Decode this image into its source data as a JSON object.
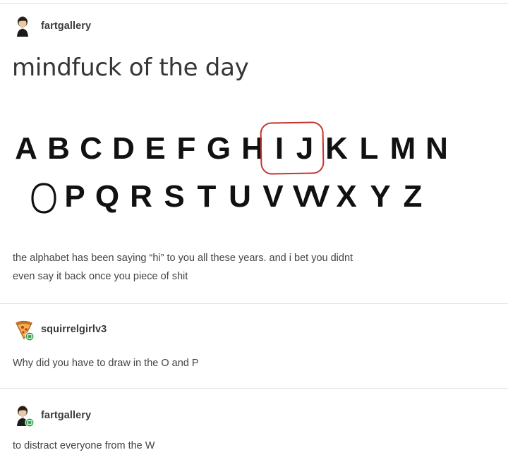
{
  "post": {
    "username": "fartgallery",
    "title": "mindfuck of the day",
    "alphabet_row1": [
      "A",
      "B",
      "C",
      "D",
      "E",
      "F",
      "G",
      "H",
      "I",
      "J",
      "K",
      "L",
      "M",
      "N"
    ],
    "alphabet_row2": [
      "P",
      "Q",
      "R",
      "S",
      "T",
      "U",
      "V",
      "VV",
      "X",
      "Y",
      "Z"
    ],
    "body_line1": "the alphabet has been saying “hi” to you all these years. and i bet you didnt",
    "body_line2": "even say it back once you piece of shit"
  },
  "replies": [
    {
      "username": "squirrelgirlv3",
      "text": "Why did you have to draw in the O and P",
      "avatar_icon": "pizza-slice-avatar-icon"
    },
    {
      "username": "fartgallery",
      "text": "to distract everyone from the W",
      "avatar_icon": "person-avatar-icon"
    }
  ],
  "colors": {
    "circle": "#c8322c",
    "badge": "#2ea24e",
    "divider": "#e2e2e2"
  }
}
